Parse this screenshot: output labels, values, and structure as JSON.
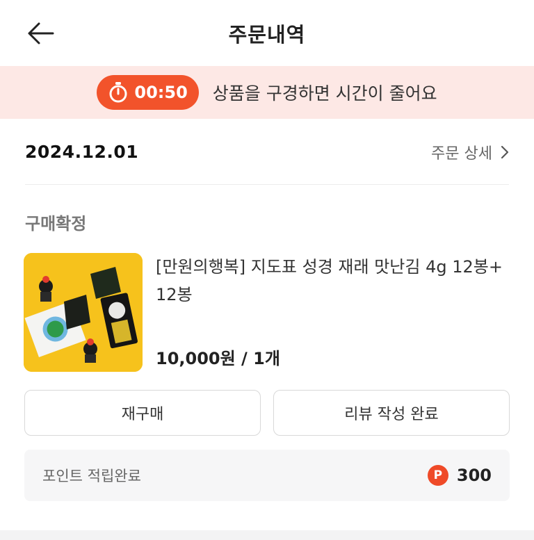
{
  "header": {
    "title": "주문내역",
    "back_icon": "arrow-left-icon"
  },
  "banner": {
    "timer": "00:50",
    "message": "상품을 구경하면 시간이 줄어요",
    "accent_color": "#f2532b",
    "background_color": "#fde8e5",
    "timer_icon": "stopwatch-icon"
  },
  "order": {
    "date": "2024.12.01",
    "detail_label": "주문 상세",
    "status": "구매확정"
  },
  "product": {
    "name": "[만원의행복] 지도표 성경 재래 맛난김 4g 12봉+12봉",
    "price_qty": "10,000원 / 1개",
    "image_icon": "seaweed-product-image"
  },
  "actions": {
    "rebuy_label": "재구매",
    "review_label": "리뷰 작성 완료"
  },
  "points": {
    "label": "포인트 적립완료",
    "badge": "P",
    "value": "300"
  }
}
